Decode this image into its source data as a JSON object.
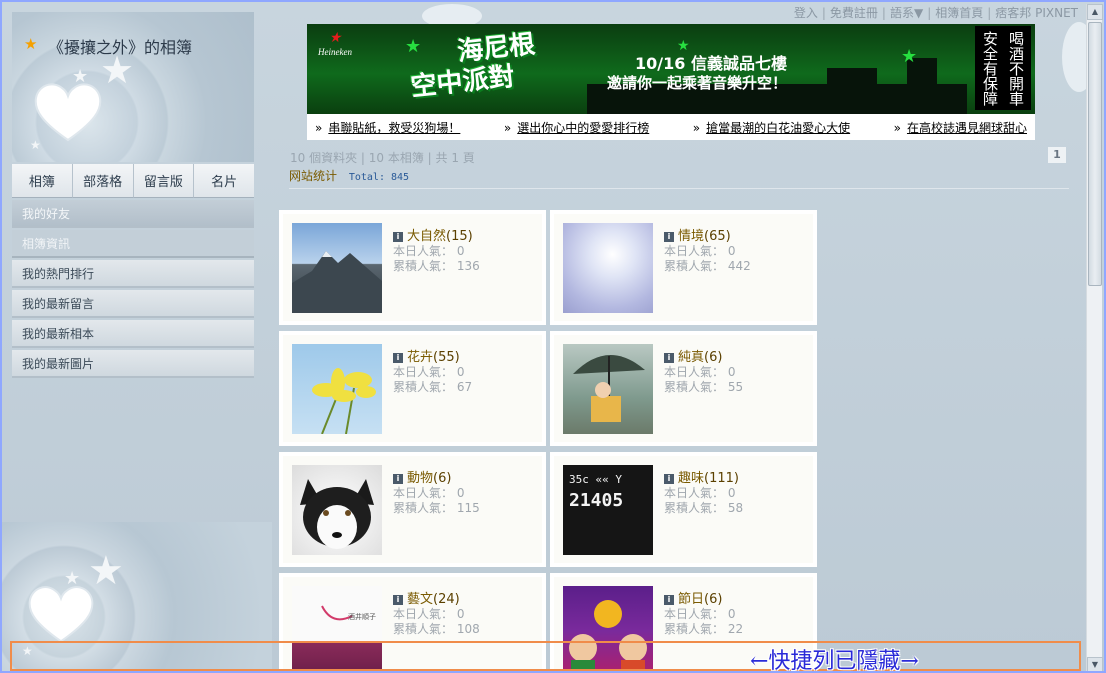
{
  "toplinks": [
    "登入",
    "免費註冊",
    "語系▼",
    "相簿首頁",
    "痞客邦 PIXNET"
  ],
  "album_title": "《擾攘之外》的相簿",
  "tabs": [
    "相簿",
    "部落格",
    "留言版",
    "名片"
  ],
  "menu": [
    "我的好友",
    "相簿資訊",
    "我的熱門排行",
    "我的最新留言",
    "我的最新相本",
    "我的最新圖片"
  ],
  "banner": {
    "brand": "Heineken",
    "headline_1": "海尼根",
    "headline_2": "空中派對",
    "date_line": "10/16 信義誠品七樓",
    "sub_line": "邀請你一起乘著音樂升空！",
    "warning": [
      "喝酒不開車",
      "安全有保障"
    ],
    "links": [
      "串聯貼紙，救受災狗場！",
      "選出你心中的愛愛排行榜",
      "搶當最潮的白花油愛心大使",
      "在高校誌遇見網球甜心"
    ]
  },
  "summary": "10 個資料夾 | 10 本相簿 | 共 1 頁",
  "stats_label": "网站统计",
  "stats_total": "Total: 845",
  "page_number": "1",
  "albums": [
    {
      "name": "大自然",
      "count": "(15)",
      "today_label": "本日人氣：",
      "today": "0",
      "total_label": "累積人氣：",
      "total": "136",
      "thumb": "t-mountain"
    },
    {
      "name": "情境",
      "count": "(65)",
      "today_label": "本日人氣：",
      "today": "0",
      "total_label": "累積人氣：",
      "total": "442",
      "thumb": "t-light"
    },
    {
      "name": "花卉",
      "count": "(55)",
      "today_label": "本日人氣：",
      "today": "0",
      "total_label": "累積人氣：",
      "total": "67",
      "thumb": "t-flower"
    },
    {
      "name": "純真",
      "count": "(6)",
      "today_label": "本日人氣：",
      "today": "0",
      "total_label": "累積人氣：",
      "total": "55",
      "thumb": "t-kid"
    },
    {
      "name": "動物",
      "count": "(6)",
      "today_label": "本日人氣：",
      "today": "0",
      "total_label": "累積人氣：",
      "total": "115",
      "thumb": "t-dog"
    },
    {
      "name": "趣味",
      "count": "(111)",
      "today_label": "本日人氣：",
      "today": "0",
      "total_label": "累積人氣：",
      "total": "58",
      "thumb": "t-sign"
    },
    {
      "name": "藝文",
      "count": "(24)",
      "today_label": "本日人氣：",
      "today": "0",
      "total_label": "累積人氣：",
      "total": "108",
      "thumb": "t-book"
    },
    {
      "name": "節日",
      "count": "(6)",
      "today_label": "本日人氣：",
      "today": "0",
      "total_label": "累積人氣：",
      "total": "22",
      "thumb": "t-fest"
    }
  ],
  "thumb_text": {
    "sign_1": "35c",
    "sign_2": "21405",
    "book": "酒井順子"
  },
  "quickbar_text": "←快捷列已隱藏→",
  "colors": {
    "frame": "#8fa7ff",
    "quickbar_border": "#f08c4a",
    "quickbar_text": "#2a2ad8",
    "album_name": "#7a5a00"
  }
}
